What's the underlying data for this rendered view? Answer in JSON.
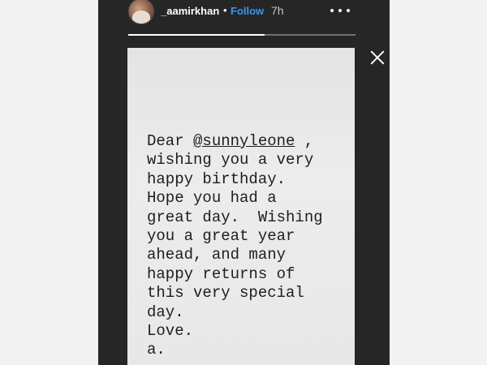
{
  "header": {
    "username": "_aamirkhan",
    "separator": "•",
    "follow_label": "Follow",
    "time": "7h",
    "more_icon": "more-horizontal-icon"
  },
  "progress": {
    "fraction": 0.6
  },
  "close_icon": "close-icon",
  "note": {
    "line1_prefix": "Dear ",
    "mention": "@sunnyleone",
    "line1_suffix": " ,",
    "line2": "wishing you a very",
    "line3": "happy birthday.",
    "line4": "Hope you had a",
    "line5": "great day.  Wishing",
    "line6": "you a great year",
    "line7": "ahead, and many",
    "line8": "happy returns of",
    "line9": "this very special",
    "line10": "day.",
    "line11": "Love.",
    "line12": "a."
  },
  "colors": {
    "background": "#262626",
    "follow": "#3897f0",
    "card": "#e8e8e8"
  }
}
